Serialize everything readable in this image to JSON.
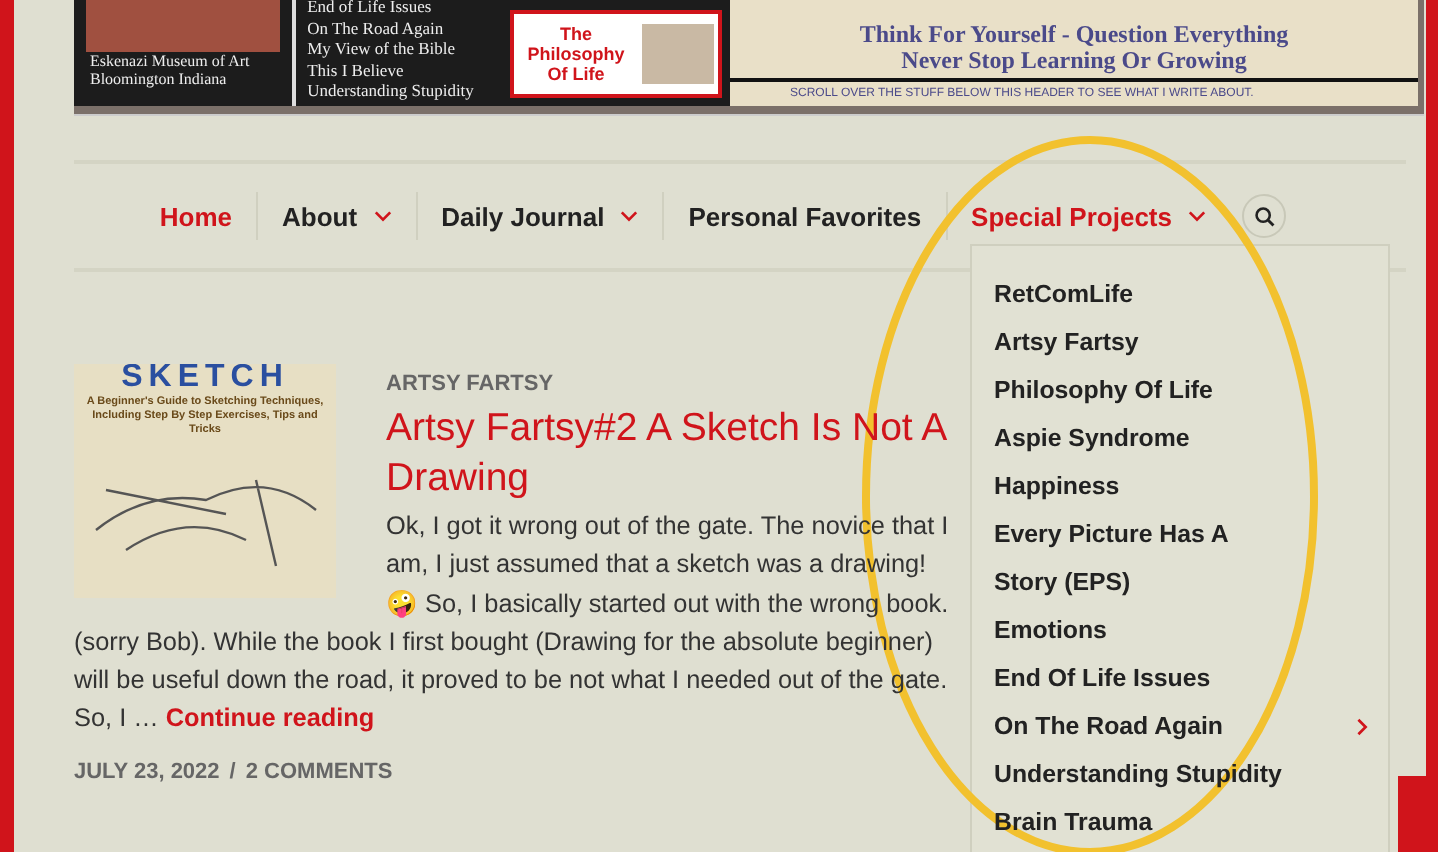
{
  "header_banner": {
    "photo_caption": "Eskenazi Museum of Art Bloomington Indiana",
    "topics": [
      "End of Life Issues",
      "On The Road Again",
      "My View of the Bible",
      "This I Believe",
      "Understanding Stupidity"
    ],
    "promo_title": "The Philosophy Of Life",
    "motto": [
      "Think For Yourself - Question Everything",
      "Never Stop Learning Or Growing"
    ],
    "hint": "SCROLL OVER THE STUFF BELOW THIS HEADER TO SEE WHAT I WRITE ABOUT."
  },
  "nav": {
    "items": [
      {
        "label": "Home",
        "active": true,
        "has_submenu": false
      },
      {
        "label": "About",
        "active": false,
        "has_submenu": true
      },
      {
        "label": "Daily Journal",
        "active": false,
        "has_submenu": true
      },
      {
        "label": "Personal Favorites",
        "active": false,
        "has_submenu": false
      },
      {
        "label": "Special Projects",
        "active": true,
        "has_submenu": true
      }
    ]
  },
  "dropdown": {
    "items": [
      {
        "label": "RetComLife",
        "has_submenu": false
      },
      {
        "label": "Artsy Fartsy",
        "has_submenu": false
      },
      {
        "label": "Philosophy Of Life",
        "has_submenu": false
      },
      {
        "label": "Aspie Syndrome",
        "has_submenu": false
      },
      {
        "label": "Happiness",
        "has_submenu": false
      },
      {
        "label": "Every Picture Has A Story (EPS)",
        "has_submenu": false
      },
      {
        "label": "Emotions",
        "has_submenu": false
      },
      {
        "label": "End Of Life Issues",
        "has_submenu": false
      },
      {
        "label": "On The Road Again",
        "has_submenu": true
      },
      {
        "label": "Understanding Stupidity",
        "has_submenu": false
      },
      {
        "label": "Brain Trauma",
        "has_submenu": false
      }
    ]
  },
  "post": {
    "thumbnail": {
      "title": "SKETCH",
      "subtitle": "A Beginner's Guide to Sketching Techniques, Including Step By Step Exercises, Tips and Tricks"
    },
    "category": "ARTSY FARTSY",
    "title": "Artsy Fartsy#2 A Sketch Is Not A Drawing",
    "excerpt": "Ok, I got it wrong out of the gate. The novice that I am, I just assumed that a sketch was a drawing!🤪 So, I basically started out with the wrong book. (sorry Bob). While the book I first bought (Drawing for the absolute beginner) will be useful down the road, it proved to be not what I needed out of the gate. So, I …",
    "read_more": "Continue reading",
    "date": "JULY 23, 2022",
    "separator": "/",
    "comments": "2 COMMENTS"
  }
}
